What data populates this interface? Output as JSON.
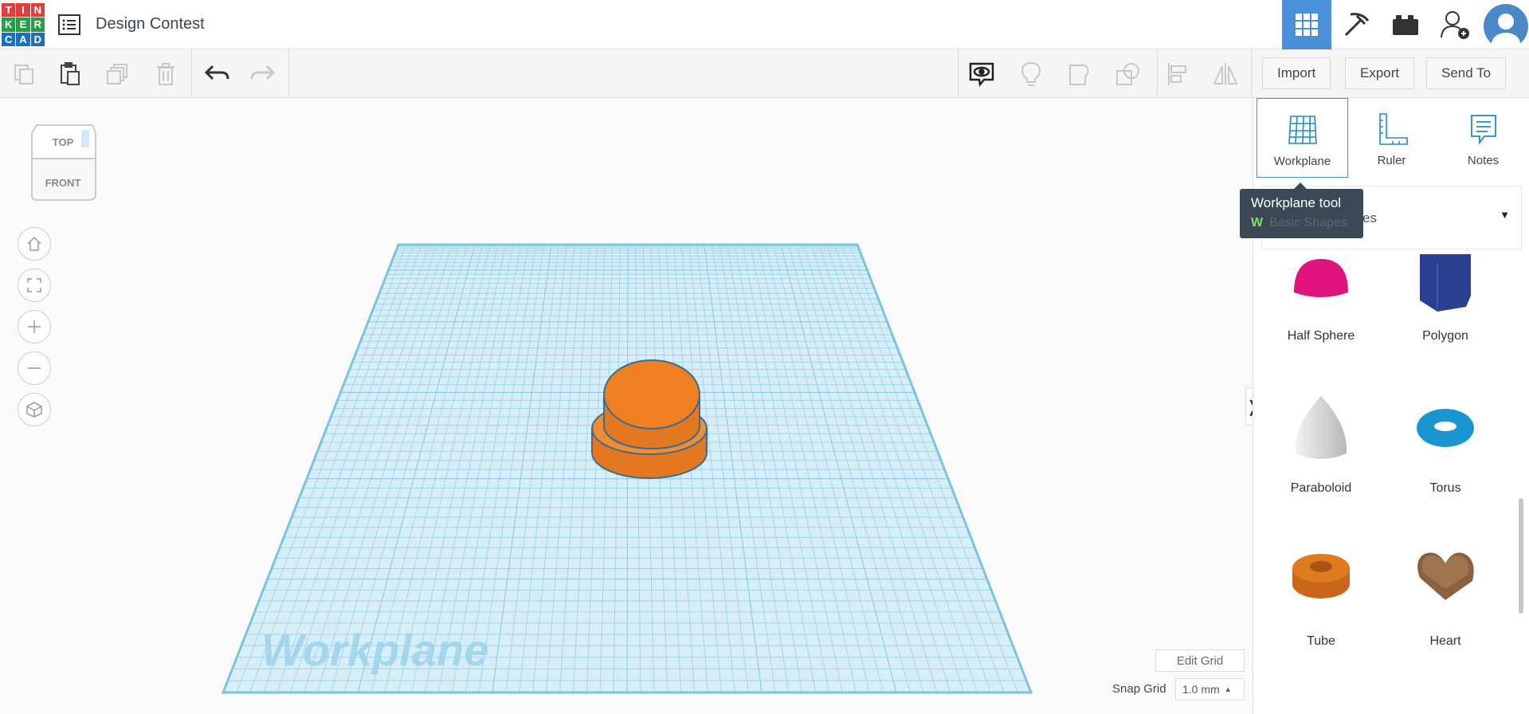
{
  "app": {
    "logo_letters": [
      "T",
      "I",
      "N",
      "K",
      "E",
      "R",
      "C",
      "A",
      "D"
    ],
    "logo_colors": [
      "#e23d3d",
      "#e23d3d",
      "#e23d3d",
      "#2a9d4b",
      "#2a9d4b",
      "#2a9d4b",
      "#1d6fb8",
      "#1d6fb8",
      "#1d6fb8"
    ],
    "design_title": "Design Contest"
  },
  "header": {
    "icons": [
      "grid-view-icon",
      "pickaxe-icon",
      "bricks-icon",
      "add-user-icon",
      "user-avatar"
    ],
    "active_color": "#4a90d9"
  },
  "toolbar": {
    "left_tools": [
      "copy-icon",
      "paste-icon",
      "duplicate-icon",
      "delete-icon",
      "undo-icon",
      "redo-icon"
    ],
    "right_tools": [
      "notes-visibility-icon",
      "bulb-icon",
      "group-icon",
      "ungroup-icon",
      "align-icon",
      "mirror-icon"
    ],
    "import_label": "Import",
    "export_label": "Export",
    "send_to_label": "Send To"
  },
  "viewcube": {
    "top_label": "TOP",
    "front_label": "FRONT"
  },
  "nav": [
    "home-view-icon",
    "fit-view-icon",
    "zoom-in-icon",
    "zoom-out-icon",
    "perspective-icon"
  ],
  "workplane": {
    "watermark": "Workplane",
    "edit_grid_label": "Edit Grid",
    "snap_grid_label": "Snap Grid",
    "snap_grid_value": "1.0 mm",
    "grid_color": "#8fd0e8",
    "shape_color": "#ea7b22"
  },
  "panel": {
    "tools": [
      {
        "label": "Workplane",
        "icon": "workplane-icon"
      },
      {
        "label": "Ruler",
        "icon": "ruler-icon"
      },
      {
        "label": "Notes",
        "icon": "notes-icon"
      }
    ],
    "category": "Basic Shapes",
    "shapes": [
      {
        "label": "Half Sphere",
        "color": "#e0147e"
      },
      {
        "label": "Polygon",
        "color": "#2a3f8f"
      },
      {
        "label": "Paraboloid",
        "color": "#d9d9d9"
      },
      {
        "label": "Torus",
        "color": "#1a95d0"
      },
      {
        "label": "Tube",
        "color": "#e07a1f"
      },
      {
        "label": "Heart",
        "color": "#8a6040"
      }
    ]
  },
  "tooltip": {
    "title": "Workplane tool",
    "shortcut": "W"
  }
}
